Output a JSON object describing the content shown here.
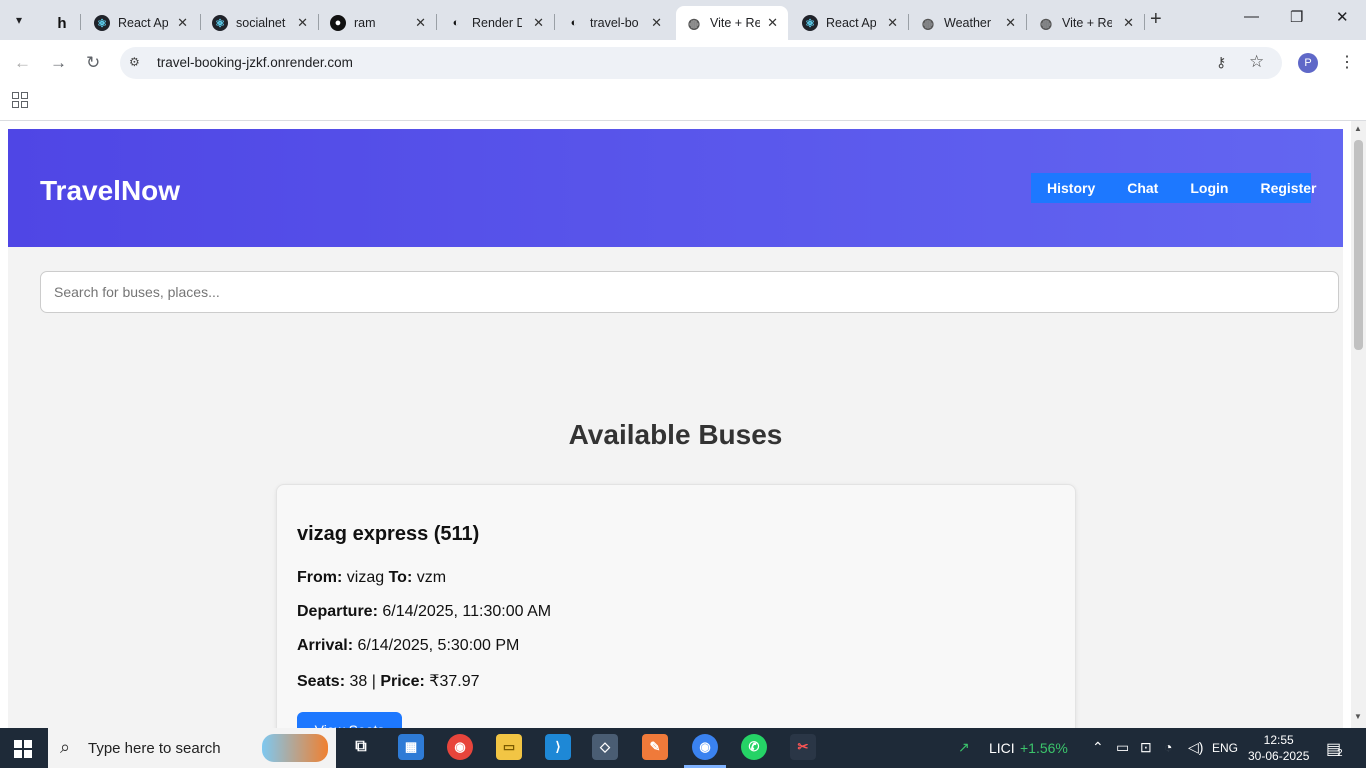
{
  "browser": {
    "tabs": [
      {
        "label": "",
        "icon": "hashnode-icon"
      },
      {
        "label": "React App",
        "icon": "react-icon"
      },
      {
        "label": "socialnet",
        "icon": "react-icon"
      },
      {
        "label": "ram",
        "icon": "github-icon"
      },
      {
        "label": "Render D",
        "icon": "render-icon"
      },
      {
        "label": "travel-bo",
        "icon": "render-icon"
      },
      {
        "label": "Vite + Re",
        "icon": "globe-icon",
        "active": true
      },
      {
        "label": "React Ap",
        "icon": "react-icon"
      },
      {
        "label": "Weather",
        "icon": "globe-icon"
      },
      {
        "label": "Vite + Re",
        "icon": "globe-icon"
      }
    ],
    "url": "travel-booking-jzkf.onrender.com",
    "profile_initial": "P"
  },
  "app": {
    "brand": "TravelNow",
    "nav": [
      "History",
      "Chat",
      "Login",
      "Register"
    ],
    "search_placeholder": "Search for buses, places...",
    "section_title": "Available Buses",
    "bus": {
      "name": "vizag express (511)",
      "from_label": "From:",
      "from": "vizag",
      "to_label": "To:",
      "to": "vzm",
      "departure_label": "Departure:",
      "departure": "6/14/2025, 11:30:00 AM",
      "arrival_label": "Arrival:",
      "arrival": "6/14/2025, 5:30:00 PM",
      "seats_label": "Seats:",
      "seats": "38",
      "separator": "|",
      "price_label": "Price:",
      "price": "₹37.97",
      "button": "View Seats"
    },
    "colors": {
      "header_start": "#4f46e5",
      "header_end": "#6366f1",
      "accent": "#1d78ff"
    }
  },
  "taskbar": {
    "search_text": "Type here to search",
    "stock_name": "LICI",
    "stock_change": "+1.56%",
    "language": "ENG",
    "time": "12:55",
    "date": "30-06-2025",
    "notifications": "2"
  }
}
